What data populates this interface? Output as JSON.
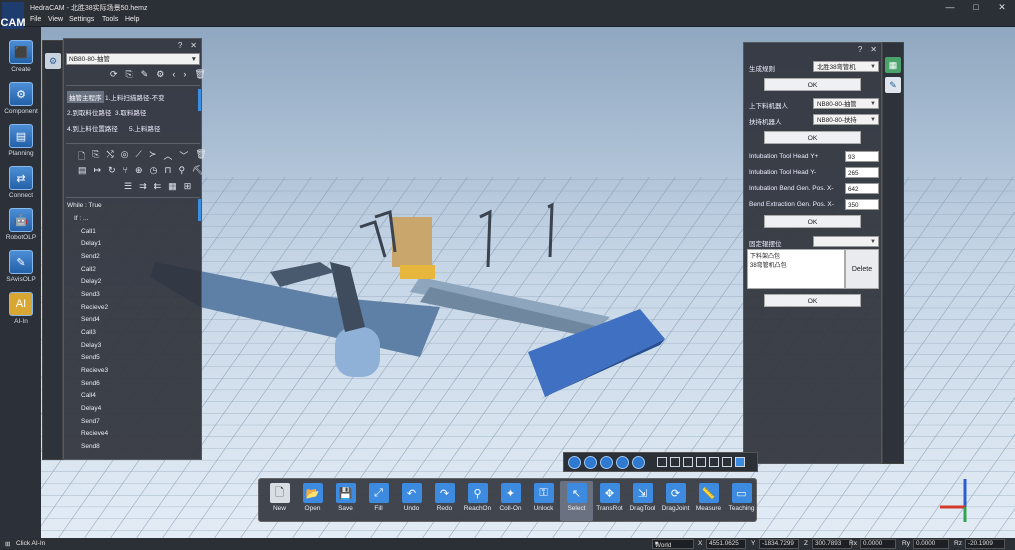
{
  "app": {
    "title": "HedraCAM - 北胜38实际场景50.hemz",
    "logo": "CAM",
    "win": [
      "—",
      "□",
      "✕"
    ]
  },
  "menu": [
    "File",
    "View",
    "Settings",
    "Tools",
    "Help"
  ],
  "leftbar": [
    {
      "label": "Create",
      "icon": "create-icon",
      "glyph": "⬛"
    },
    {
      "label": "Component",
      "icon": "component-icon",
      "glyph": "⚙"
    },
    {
      "label": "Planning",
      "icon": "planning-icon",
      "glyph": "▤"
    },
    {
      "label": "Connect",
      "icon": "connect-icon",
      "glyph": "⇄"
    },
    {
      "label": "RobotOLP",
      "icon": "robot-olp-icon",
      "glyph": "🤖"
    },
    {
      "label": "SAvisOLP",
      "icon": "savis-olp-icon",
      "glyph": "✎"
    },
    {
      "label": "AI-In",
      "icon": "ai-in-icon",
      "glyph": "AI"
    }
  ],
  "left_panel": {
    "help": "?",
    "close": "✕",
    "combo": "NB80-80-抽管",
    "tabs": [
      "抽管主程序",
      "1.上料扫描路径-不变",
      "2.到取料位路径",
      "3.取料路径",
      "4.到上料位置路径",
      "5.上料路径"
    ],
    "code": [
      "While : True",
      "If : ...",
      "Call1",
      "Delay1",
      "Send2",
      "Call2",
      "Delay2",
      "Send3",
      "Recieve2",
      "Send4",
      "Call3",
      "Delay3",
      "Send5",
      "Recieve3",
      "Send6",
      "Call4",
      "Delay4",
      "Send7",
      "Recieve4",
      "Send8"
    ]
  },
  "right_panel": {
    "help": "?",
    "close": "✕",
    "gen_rule_label": "生成规则",
    "gen_rule_value": "北胜38弯管机",
    "ok": "OK",
    "loader_label": "上下料机器人",
    "loader_value": "NB80-80-抽管",
    "holder_label": "扶持机器人",
    "holder_value": "NB80-80-扶持",
    "fields": [
      {
        "label": "Intubation Tool Head Y+",
        "value": "93"
      },
      {
        "label": "Intubation Tool Head Y-",
        "value": "265"
      },
      {
        "label": "Intubation Bend Gen. Pos. X-",
        "value": "642"
      },
      {
        "label": "Bend Extraction Gen. Pos. X-",
        "value": "350"
      }
    ],
    "fixed_label": "固定辊摆位",
    "list": [
      "下料架凸包",
      "38弯管机凸包"
    ],
    "delete": "Delete"
  },
  "toolbar": [
    {
      "label": "New",
      "icon": "new-file-icon",
      "glyph": "🗋",
      "color": "#d8dde4"
    },
    {
      "label": "Open",
      "icon": "open-folder-icon",
      "glyph": "📂",
      "color": "#3d8be0"
    },
    {
      "label": "Save",
      "icon": "save-icon",
      "glyph": "💾",
      "color": "#3d8be0"
    },
    {
      "label": "Fill",
      "icon": "fill-icon",
      "glyph": "⤢",
      "color": "#3d8be0"
    },
    {
      "label": "Undo",
      "icon": "undo-icon",
      "glyph": "↶",
      "color": "#3d8be0"
    },
    {
      "label": "Redo",
      "icon": "redo-icon",
      "glyph": "↷",
      "color": "#3d8be0"
    },
    {
      "label": "ReachOn",
      "icon": "reach-on-icon",
      "glyph": "⚲",
      "color": "#3d8be0"
    },
    {
      "label": "Coll-On",
      "icon": "collision-on-icon",
      "glyph": "✦",
      "color": "#3d8be0"
    },
    {
      "label": "Unlock",
      "icon": "unlock-icon",
      "glyph": "⚿",
      "color": "#3d8be0"
    },
    {
      "label": "Select",
      "icon": "select-cursor-icon",
      "glyph": "↖",
      "color": "#3d8be0"
    },
    {
      "label": "TransRot",
      "icon": "trans-rot-icon",
      "glyph": "✥",
      "color": "#3d8be0"
    },
    {
      "label": "DragTool",
      "icon": "drag-tool-icon",
      "glyph": "⇲",
      "color": "#3d8be0"
    },
    {
      "label": "DragJoint",
      "icon": "drag-joint-icon",
      "glyph": "⟳",
      "color": "#3d8be0"
    },
    {
      "label": "Measure",
      "icon": "measure-icon",
      "glyph": "📏",
      "color": "#3d8be0"
    },
    {
      "label": "Teaching",
      "icon": "teaching-icon",
      "glyph": "▭",
      "color": "#3d8be0"
    }
  ],
  "status": {
    "msg": "Click AI-In",
    "frame": "World",
    "x_label": "X",
    "x": "4551.0625",
    "y_label": "Y",
    "y": "-1834.7299",
    "z_label": "Z",
    "z": "300.7893",
    "rx_label": "Rx",
    "rx": "0.0000",
    "ry_label": "Ry",
    "ry": "0.0000",
    "rz_label": "Rz",
    "rz": "-20.1909"
  },
  "colors": {
    "accent": "#3d8be0",
    "panel": "#30343c"
  }
}
